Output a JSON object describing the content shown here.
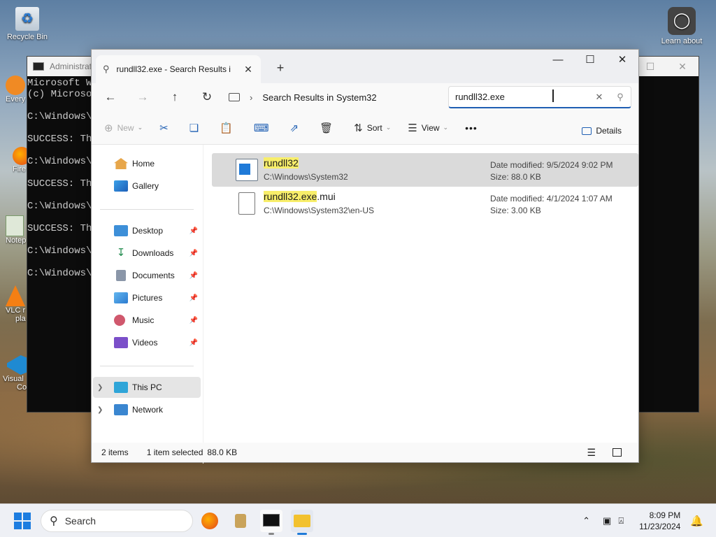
{
  "desktop": {
    "icons": [
      {
        "label": "Recycle Bin"
      },
      {
        "label": "Learn about"
      },
      {
        "label": "Every"
      },
      {
        "label": "Fire"
      },
      {
        "label": "Notep"
      },
      {
        "label": "VLC r"
      },
      {
        "label": "pla"
      },
      {
        "label": "Visual"
      },
      {
        "label": "Co"
      }
    ]
  },
  "terminal": {
    "title": "Administrat",
    "lines": [
      "Microsoft Wi",
      "(c) Microso",
      "C:\\Windows\\S",
      "SUCCESS: The",
      "C:\\Windows\\S",
      "SUCCESS: The",
      "C:\\Windows\\S",
      "SUCCESS: The",
      "C:\\Windows\\S",
      "C:\\Windows\\S"
    ]
  },
  "explorer": {
    "tab_title": "rundll32.exe - Search Results i",
    "new_tab": "+",
    "address": "Search Results in System32",
    "search_value": "rundll32.exe",
    "toolbar": {
      "new": "New",
      "sort": "Sort",
      "view": "View",
      "more": "•••",
      "details": "Details"
    },
    "sidebar": {
      "home": "Home",
      "gallery": "Gallery",
      "desktop": "Desktop",
      "downloads": "Downloads",
      "documents": "Documents",
      "pictures": "Pictures",
      "music": "Music",
      "videos": "Videos",
      "thispc": "This PC",
      "network": "Network"
    },
    "files": [
      {
        "name_match": "rundll32",
        "name_rest": "",
        "path": "C:\\Windows\\System32",
        "modified": "Date modified: 9/5/2024 9:02 PM",
        "size": "Size: 88.0 KB"
      },
      {
        "name_match": "rundll32.exe",
        "name_rest": ".mui",
        "path": "C:\\Windows\\System32\\en-US",
        "modified": "Date modified: 4/1/2024 1:07 AM",
        "size": "Size: 3.00 KB"
      }
    ],
    "status": {
      "count": "2 items",
      "selected": "1 item selected",
      "size": "88.0 KB"
    }
  },
  "taskbar": {
    "search": "Search",
    "time": "8:09 PM",
    "date": "11/23/2024"
  },
  "colors": {
    "accent": "#1f5fb3",
    "highlight": "#f8ee6a",
    "selected_row": "#dadada"
  }
}
